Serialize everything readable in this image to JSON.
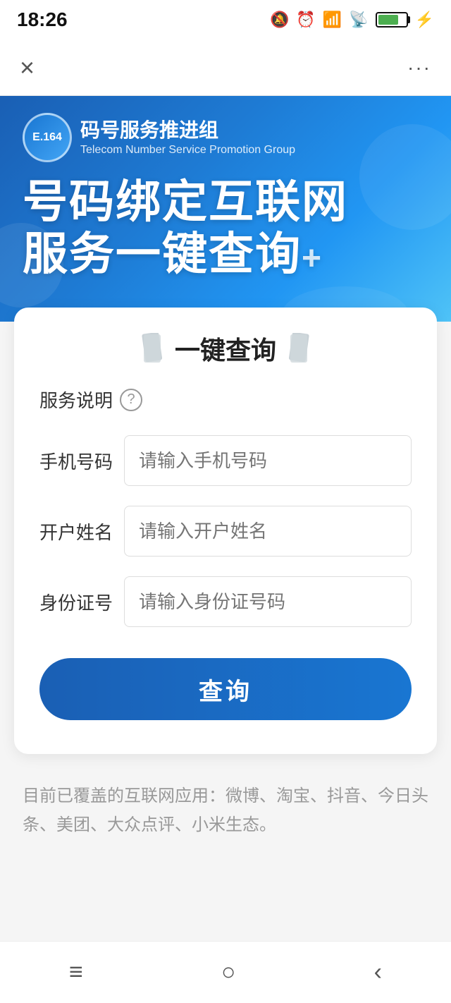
{
  "statusBar": {
    "time": "18:26",
    "batteryPercent": "76"
  },
  "navBar": {
    "closeLabel": "×",
    "moreLabel": "···"
  },
  "banner": {
    "logoText": "E.164",
    "orgName": "码号服务推进组",
    "orgSub": "Telecom Number Service  Promotion Group",
    "titleLine1": "号码绑定互联网",
    "titleLine2": "服务一键查询",
    "titlePlus": "+"
  },
  "card": {
    "titleIconLeft": "📋",
    "title": "一键查询",
    "titleIconRight": "📋",
    "serviceNoteLabel": "服务说明",
    "serviceNoteIconTitle": "?"
  },
  "form": {
    "phoneLabel": "手机号码",
    "phonePlaceholder": "请输入手机号码",
    "nameLabel": "开户姓名",
    "namePlaceholder": "请输入开户姓名",
    "idLabel": "身份证号",
    "idPlaceholder": "请输入身份证号码",
    "queryButtonLabel": "查询"
  },
  "coverageText": "目前已覆盖的互联网应用：微博、淘宝、抖音、今日头条、美团、大众点评、小米生态。",
  "bottomNav": {
    "menuIcon": "≡",
    "homeIcon": "○",
    "backIcon": "‹"
  }
}
